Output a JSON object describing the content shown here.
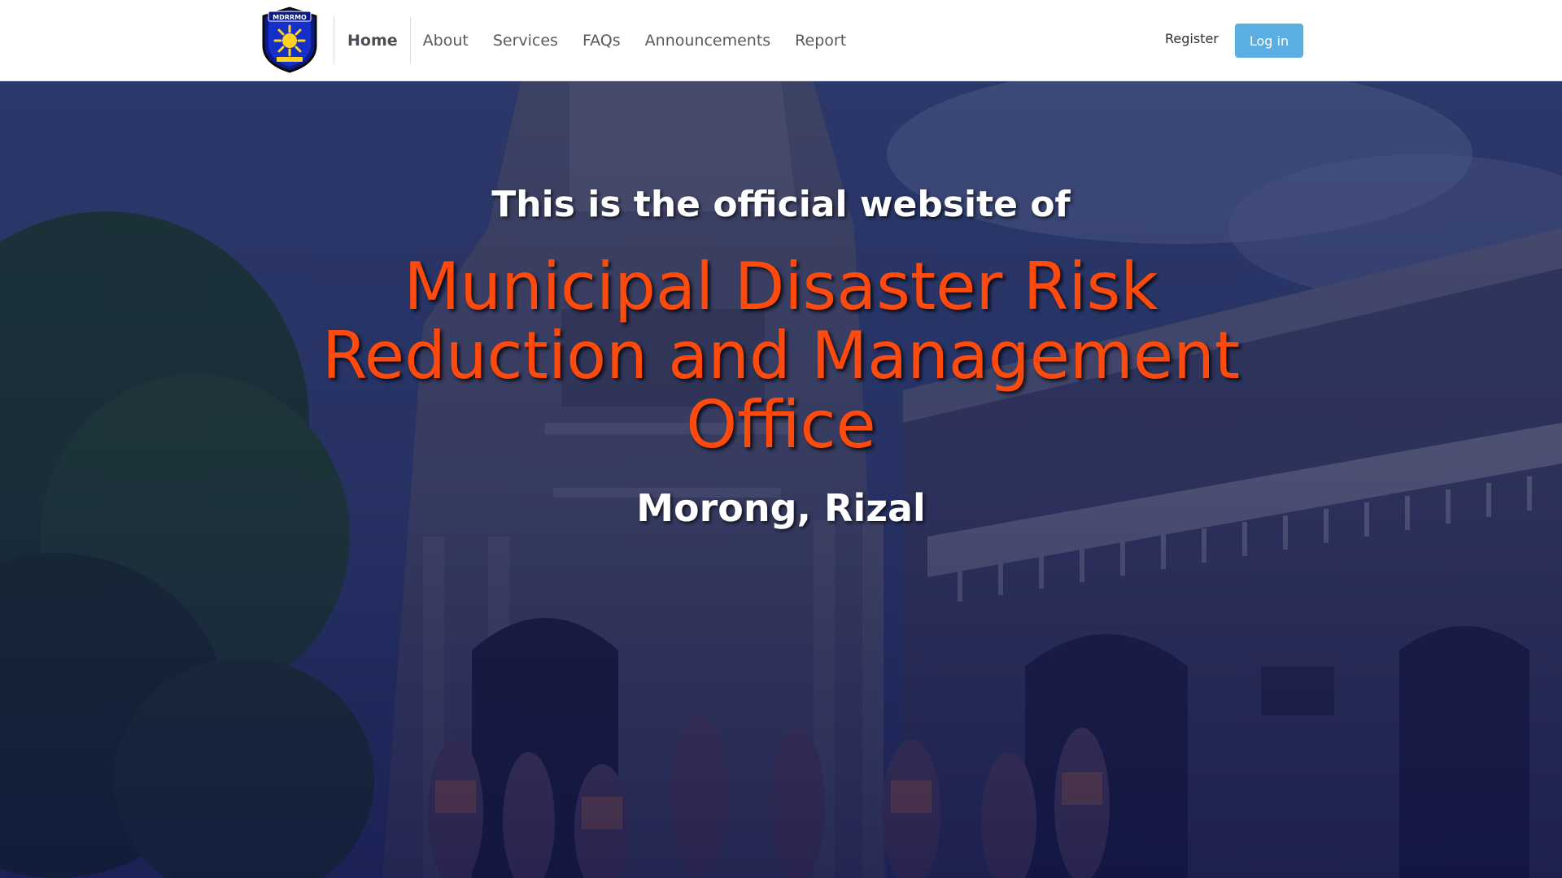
{
  "nav": {
    "logo_alt": "MDRRMO",
    "links": [
      {
        "label": "Home",
        "active": true
      },
      {
        "label": "About"
      },
      {
        "label": "Services"
      },
      {
        "label": "FAQs"
      },
      {
        "label": "Announcements"
      },
      {
        "label": "Report"
      }
    ],
    "register_label": "Register",
    "login_label": "Log in"
  },
  "hero": {
    "intro": "This is the official website of",
    "title": "Municipal Disaster Risk Reduction and Management Office",
    "location": "Morong, Rizal"
  },
  "colors": {
    "accent_orange": "#ff4a0e",
    "login_button": "#5aaee4",
    "overlay_navy": "#1c2458"
  },
  "icons": {
    "logo": "mdrrmo-seal-icon"
  }
}
